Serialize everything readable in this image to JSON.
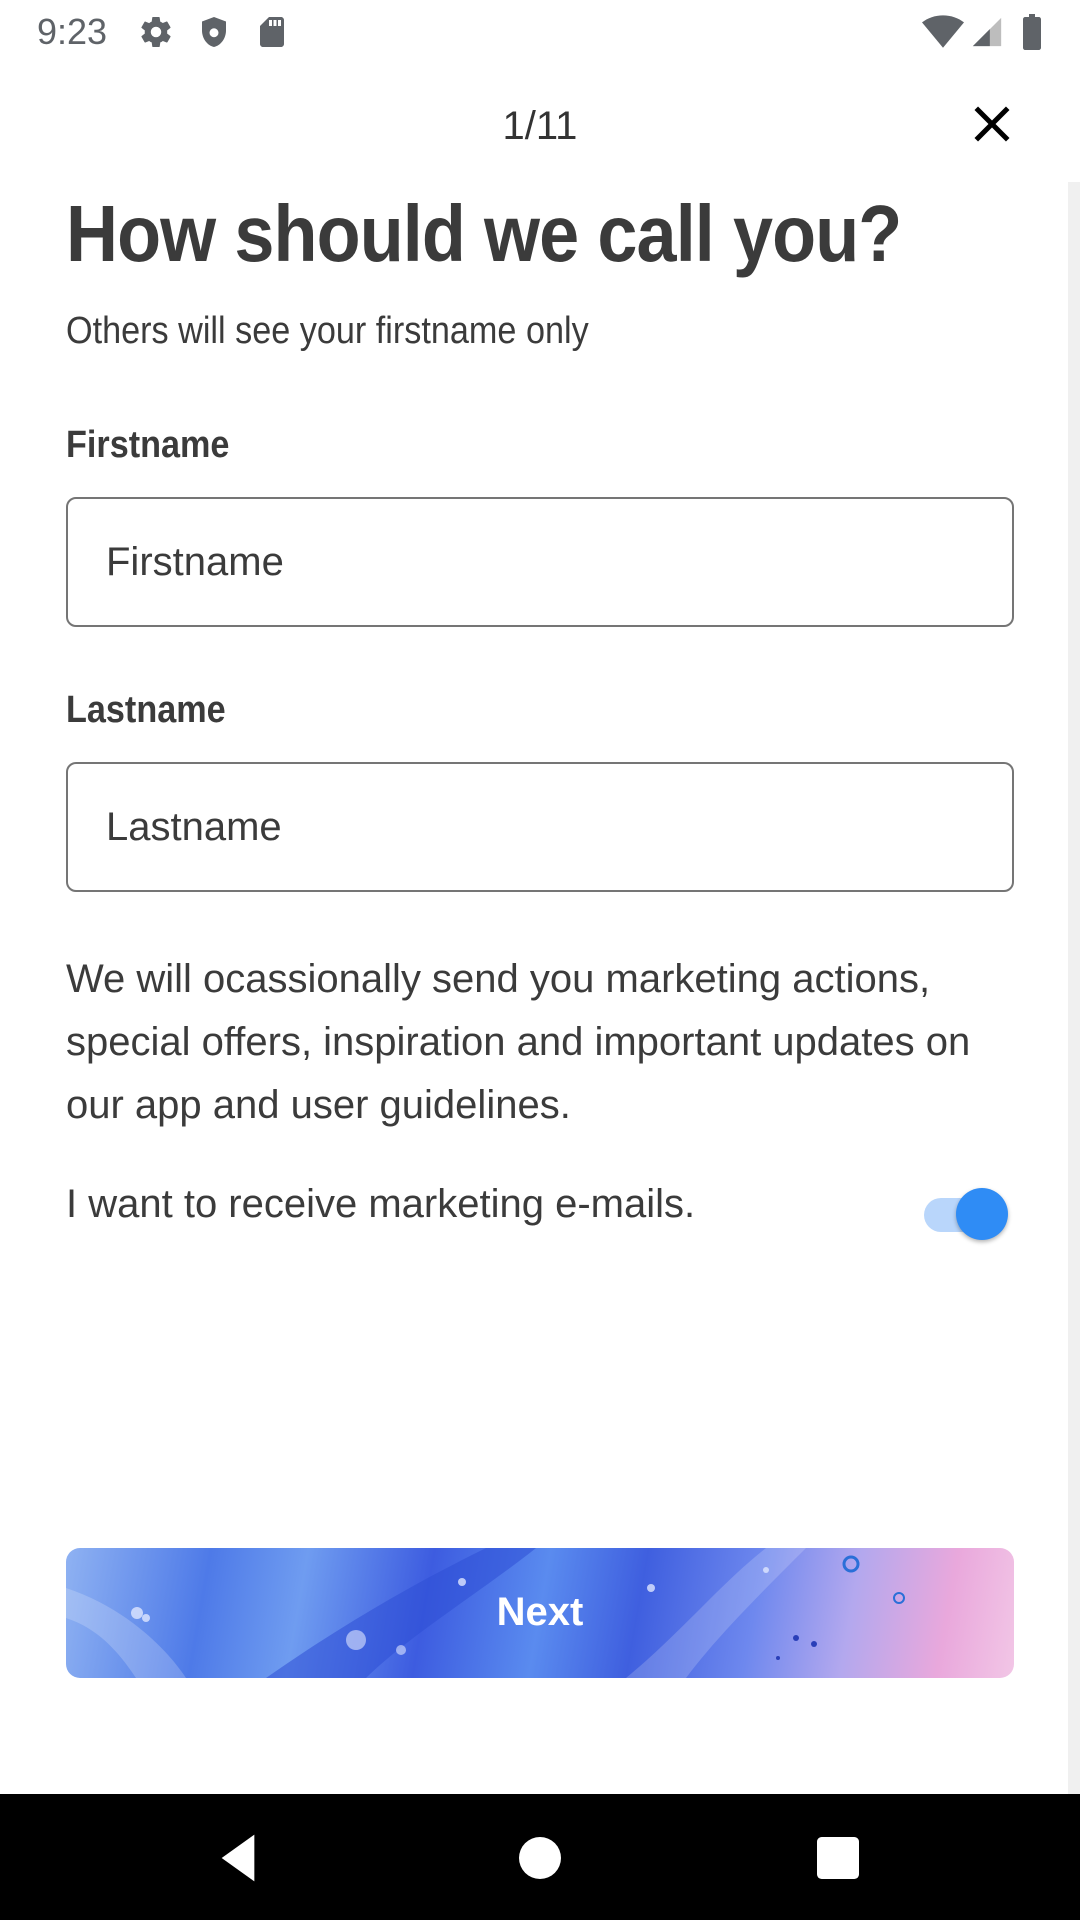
{
  "status_bar": {
    "time": "9:23",
    "left_icons": [
      "gear-icon",
      "shield-icon",
      "sd-card-icon"
    ],
    "right_icons": [
      "wifi-icon",
      "cell-signal-icon",
      "battery-icon"
    ]
  },
  "header": {
    "progress": "1/11",
    "close_icon": "close-icon"
  },
  "title": "How should we call you?",
  "subtitle": "Others will see your firstname only",
  "fields": {
    "firstname": {
      "label": "Firstname",
      "placeholder": "Firstname",
      "value": ""
    },
    "lastname": {
      "label": "Lastname",
      "placeholder": "Lastname",
      "value": ""
    }
  },
  "marketing": {
    "text": "We will ocassionally send you marketing actions, special offers, inspiration and important updates on our app and user guidelines.",
    "toggle_label": "I want to receive marketing e-mails.",
    "toggle_on": true
  },
  "next_button": {
    "label": "Next"
  },
  "nav_bar": {
    "buttons": [
      "back-icon",
      "home-icon",
      "recents-icon"
    ]
  },
  "colors": {
    "text": "#3b3b3b",
    "toggle_thumb": "#2f8cf5",
    "toggle_track": "#b9d6fb",
    "input_border": "#757575"
  }
}
